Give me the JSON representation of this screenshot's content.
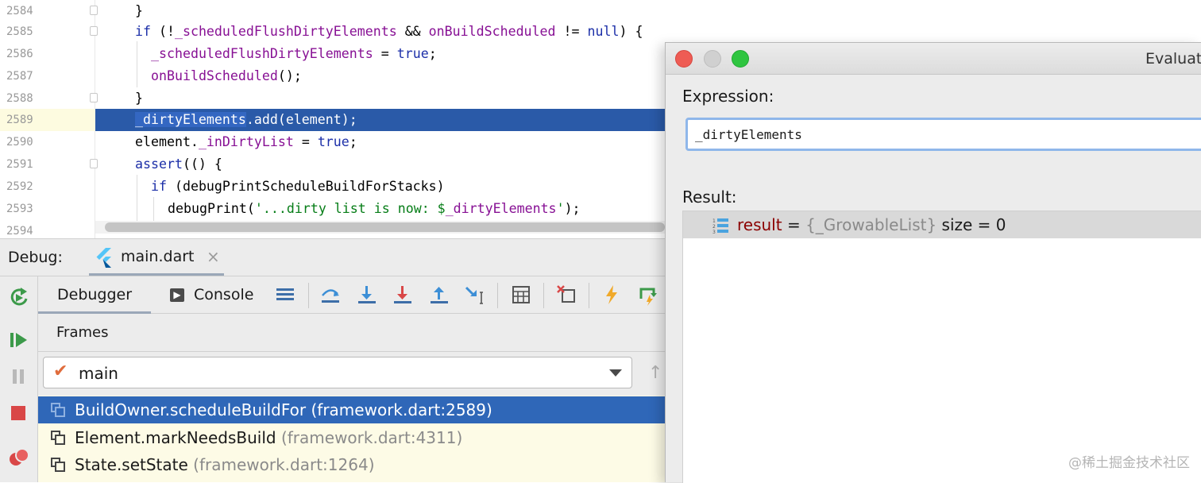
{
  "editor": {
    "lines": [
      {
        "num": "2584",
        "indent": 0
      },
      {
        "num": "2585",
        "indent": 0
      },
      {
        "num": "2586",
        "indent": 1
      },
      {
        "num": "2587",
        "indent": 1
      },
      {
        "num": "2588",
        "indent": 0
      },
      {
        "num": "2589",
        "indent": 0
      },
      {
        "num": "2590",
        "indent": 0
      },
      {
        "num": "2591",
        "indent": 0
      },
      {
        "num": "2592",
        "indent": 1
      },
      {
        "num": "2593",
        "indent": 2
      },
      {
        "num": "2594",
        "indent": 0
      }
    ],
    "tokens": {
      "l2584": "}",
      "l2585_if": "if",
      "l2585_a": " (!",
      "l2585_f1": "_scheduledFlushDirtyElements",
      "l2585_b": " && ",
      "l2585_f2": "onBuildScheduled",
      "l2585_c": " != ",
      "l2585_null": "null",
      "l2585_d": ") {",
      "l2586_f": "_scheduledFlushDirtyElements",
      "l2586_a": " = ",
      "l2586_true": "true",
      "l2586_b": ";",
      "l2587_f": "onBuildScheduled",
      "l2587_a": "();",
      "l2588": "}",
      "l2589_sel": "_dirtyElements",
      "l2589_rest": ".add(element);",
      "l2590_a": "element.",
      "l2590_f": "_inDirtyList",
      "l2590_b": " = ",
      "l2590_true": "true",
      "l2590_c": ";",
      "l2591_kw": "assert",
      "l2591_a": "(() {",
      "l2592_if": "if",
      "l2592_a": " (debugPrintScheduleBuildForStacks)",
      "l2593_a": "debugPrint(",
      "l2593_s1": "'...dirty list is now: $",
      "l2593_f": "_dirtyElements",
      "l2593_s2": "'",
      "l2593_b": ");"
    }
  },
  "debug": {
    "label": "Debug:",
    "tab": "main.dart",
    "close_glyph": "×"
  },
  "toolbar": {
    "debugger_tab": "Debugger",
    "console_tab": "Console",
    "console_glyph": "▶"
  },
  "frames": {
    "header": "Frames",
    "thread": "main",
    "thread_check": "✔",
    "up_arrow": "↑",
    "items": [
      {
        "method": "BuildOwner.scheduleBuildFor",
        "location": "(framework.dart:2589)"
      },
      {
        "method": "Element.markNeedsBuild",
        "location": "(framework.dart:4311)"
      },
      {
        "method": "State.setState",
        "location": "(framework.dart:1264)"
      }
    ]
  },
  "dialog": {
    "title": "Evaluat",
    "expression_label": "Expression:",
    "expression_value": "_dirtyElements",
    "result_label": "Result:",
    "result": {
      "name": "result",
      "eq": " = ",
      "type": "{_GrowableList}",
      "value": " size = 0"
    }
  },
  "watermark": "@稀土掘金技术社区",
  "colors": {
    "selection": "#2a5aa8",
    "keyword": "#1c2fa8",
    "field": "#871094",
    "string": "#067d17"
  }
}
